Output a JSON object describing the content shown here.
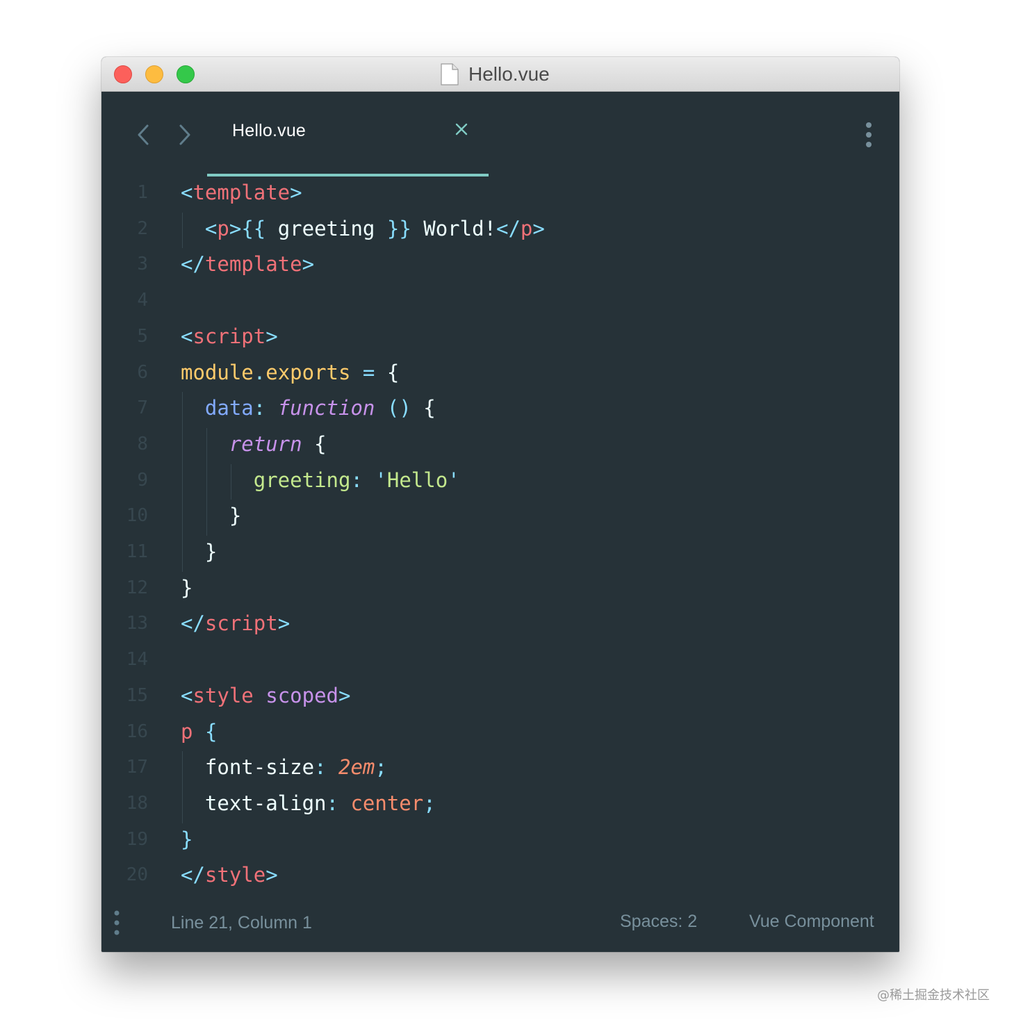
{
  "window": {
    "title": "Hello.vue",
    "traffic_lights": [
      "close",
      "minimize",
      "zoom"
    ]
  },
  "tabbar": {
    "back_icon": "chevron-left-icon",
    "forward_icon": "chevron-right-icon",
    "active_tab": {
      "label": "Hello.vue",
      "close_icon": "close-icon"
    },
    "menu_icon": "more-vertical-icon"
  },
  "editor": {
    "line_numbers": [
      "1",
      "2",
      "3",
      "4",
      "5",
      "6",
      "7",
      "8",
      "9",
      "10",
      "11",
      "12",
      "13",
      "14",
      "15",
      "16",
      "17",
      "18",
      "19",
      "20"
    ],
    "lines": [
      [
        {
          "t": "<",
          "c": "punct"
        },
        {
          "t": "template",
          "c": "tag"
        },
        {
          "t": ">",
          "c": "punct"
        }
      ],
      [
        {
          "t": "  "
        },
        {
          "t": "<",
          "c": "punct"
        },
        {
          "t": "p",
          "c": "tag"
        },
        {
          "t": ">",
          "c": "punct"
        },
        {
          "t": "{{",
          "c": "punct"
        },
        {
          "t": " greeting ",
          "c": "text"
        },
        {
          "t": "}}",
          "c": "punct"
        },
        {
          "t": " World!",
          "c": "text"
        },
        {
          "t": "</",
          "c": "punct"
        },
        {
          "t": "p",
          "c": "tag"
        },
        {
          "t": ">",
          "c": "punct"
        }
      ],
      [
        {
          "t": "</",
          "c": "punct"
        },
        {
          "t": "template",
          "c": "tag"
        },
        {
          "t": ">",
          "c": "punct"
        }
      ],
      [],
      [
        {
          "t": "<",
          "c": "punct"
        },
        {
          "t": "script",
          "c": "tag"
        },
        {
          "t": ">",
          "c": "punct"
        }
      ],
      [
        {
          "t": "module",
          "c": "var"
        },
        {
          "t": ".",
          "c": "punct"
        },
        {
          "t": "exports",
          "c": "var"
        },
        {
          "t": " ",
          "c": "text"
        },
        {
          "t": "=",
          "c": "punct"
        },
        {
          "t": " {",
          "c": "text"
        }
      ],
      [
        {
          "t": "  "
        },
        {
          "t": "data",
          "c": "prop"
        },
        {
          "t": ":",
          "c": "punct"
        },
        {
          "t": " ",
          "c": "text"
        },
        {
          "t": "function",
          "c": "kw"
        },
        {
          "t": " ",
          "c": "text"
        },
        {
          "t": "()",
          "c": "punct"
        },
        {
          "t": " {",
          "c": "text"
        }
      ],
      [
        {
          "t": "    "
        },
        {
          "t": "return",
          "c": "kw"
        },
        {
          "t": " {",
          "c": "text"
        }
      ],
      [
        {
          "t": "      "
        },
        {
          "t": "greeting",
          "c": "key"
        },
        {
          "t": ":",
          "c": "punct"
        },
        {
          "t": " ",
          "c": "text"
        },
        {
          "t": "'",
          "c": "punct"
        },
        {
          "t": "Hello",
          "c": "str"
        },
        {
          "t": "'",
          "c": "punct"
        }
      ],
      [
        {
          "t": "    "
        },
        {
          "t": "}",
          "c": "text"
        }
      ],
      [
        {
          "t": "  "
        },
        {
          "t": "}",
          "c": "text"
        }
      ],
      [
        {
          "t": "}",
          "c": "text"
        }
      ],
      [
        {
          "t": "</",
          "c": "punct"
        },
        {
          "t": "script",
          "c": "tag"
        },
        {
          "t": ">",
          "c": "punct"
        }
      ],
      [],
      [
        {
          "t": "<",
          "c": "punct"
        },
        {
          "t": "style",
          "c": "tag"
        },
        {
          "t": " ",
          "c": "text"
        },
        {
          "t": "scoped",
          "c": "attr"
        },
        {
          "t": ">",
          "c": "punct"
        }
      ],
      [
        {
          "t": "p",
          "c": "tag"
        },
        {
          "t": " ",
          "c": "text"
        },
        {
          "t": "{",
          "c": "punct"
        }
      ],
      [
        {
          "t": "  "
        },
        {
          "t": "font-size",
          "c": "css-prop"
        },
        {
          "t": ":",
          "c": "punct"
        },
        {
          "t": " ",
          "c": "text"
        },
        {
          "t": "2em",
          "c": "num"
        },
        {
          "t": ";",
          "c": "punct"
        }
      ],
      [
        {
          "t": "  "
        },
        {
          "t": "text-align",
          "c": "css-prop"
        },
        {
          "t": ":",
          "c": "punct"
        },
        {
          "t": " ",
          "c": "text"
        },
        {
          "t": "center",
          "c": "val"
        },
        {
          "t": ";",
          "c": "punct"
        }
      ],
      [
        {
          "t": "}",
          "c": "punct"
        }
      ],
      [
        {
          "t": "</",
          "c": "punct"
        },
        {
          "t": "style",
          "c": "tag"
        },
        {
          "t": ">",
          "c": "punct"
        }
      ]
    ]
  },
  "statusbar": {
    "menu_icon": "more-vertical-icon",
    "position": "Line 21, Column 1",
    "indentation": "Spaces: 2",
    "syntax": "Vue Component"
  },
  "watermark": "@稀土掘金技术社区",
  "colors": {
    "background": "#263238",
    "tab_underline": "#80cbc4",
    "line_number": "#37474f",
    "status_text": "#78909c",
    "punctuation": "#89ddff",
    "tag": "#f07178",
    "variable": "#ffcb6b",
    "property": "#82aaff",
    "keyword": "#c792ea",
    "string": "#c3e88d",
    "number": "#f78c6c",
    "text": "#eeffff"
  }
}
